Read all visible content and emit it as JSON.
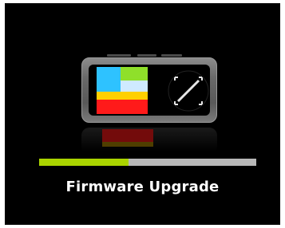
{
  "screen": {
    "title": "Firmware Upgrade",
    "progress_fraction": 0.41,
    "colors": {
      "background": "#000000",
      "progress_fill": "#aad400",
      "progress_track": "#b8b8b8",
      "text": "#ffffff"
    }
  },
  "icons": {
    "device": "portable-media-player-icon"
  }
}
